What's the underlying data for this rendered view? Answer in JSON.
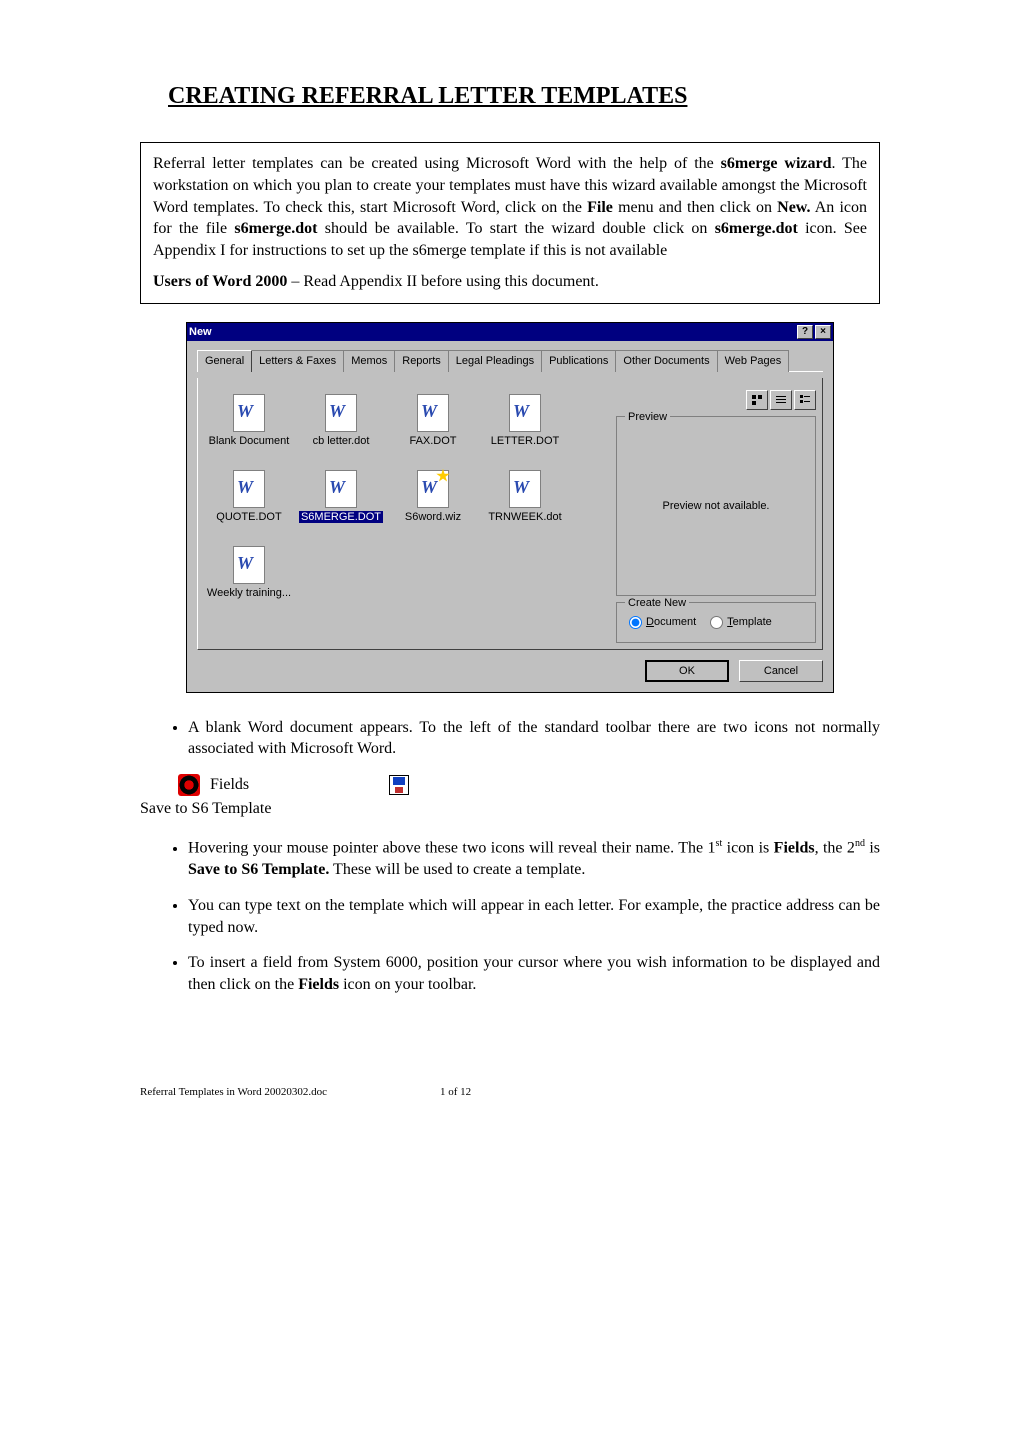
{
  "title": "CREATING REFERRAL LETTER TEMPLATES",
  "intro": {
    "p1a": "Referral letter templates can be created using Microsoft Word with the help of the ",
    "p1b": "s6merge wizard",
    "p1c": ".  The workstation on which you plan to create your templates must have this wizard available amongst the Microsoft Word templates.  To check this, start Microsoft Word, click on the ",
    "p1d": "File",
    "p1e": " menu and then click on ",
    "p1f": "New.",
    "p1g": "  An icon for the file ",
    "p1h": "s6merge.dot",
    "p1i": " should be available.  To start the wizard double click on ",
    "p1j": "s6merge.dot",
    "p1k": " icon. See Appendix I for instructions to set up the s6merge template if this is not available",
    "p2a": "Users of Word 2000",
    "p2b": " – Read Appendix II before using this document."
  },
  "dialog": {
    "title": "New",
    "help": "?",
    "close": "×",
    "tabs": [
      "General",
      "Letters & Faxes",
      "Memos",
      "Reports",
      "Legal Pleadings",
      "Publications",
      "Other Documents",
      "Web Pages"
    ],
    "files": [
      {
        "label": "Blank Document",
        "wiz": false
      },
      {
        "label": "cb letter.dot",
        "wiz": false
      },
      {
        "label": "FAX.DOT",
        "wiz": false
      },
      {
        "label": "LETTER.DOT",
        "wiz": false
      },
      {
        "label": "QUOTE.DOT",
        "wiz": false
      },
      {
        "label": "S6MERGE.DOT",
        "wiz": false,
        "selected": true
      },
      {
        "label": "S6word.wiz",
        "wiz": true
      },
      {
        "label": "TRNWEEK.dot",
        "wiz": false
      },
      {
        "label": "Weekly training...",
        "wiz": false
      }
    ],
    "previewLegend": "Preview",
    "previewText": "Preview not available.",
    "createNewLegend": "Create New",
    "radioDocument": "Document",
    "radioTemplate": "Template",
    "ok": "OK",
    "cancel": "Cancel"
  },
  "bullets": {
    "b1": "A blank Word document appears.  To the left of  the standard toolbar there are two icons not normally associated with Microsoft Word.",
    "fieldsLabel": "Fields",
    "saveLabel": "Save to S6 Template",
    "b2a": "Hovering your mouse pointer above these two icons will reveal their name.  The 1",
    "b2b": "st",
    "b2c": " icon is ",
    "b2d": "Fields",
    "b2e": ", the 2",
    "b2f": "nd",
    "b2g": " is ",
    "b2h": "Save to S6 Template.",
    "b2i": "  These will be used to create a template.",
    "b3": "You can type text on the template which will appear in each letter. For example, the practice address can be typed now.",
    "b4a": "To insert a field from System 6000, position your cursor where you wish information to be displayed and then click on the ",
    "b4b": "Fields",
    "b4c": " icon on your toolbar."
  },
  "footer": {
    "file": "Referral Templates in Word 20020302.doc",
    "page": "1 of 12"
  }
}
